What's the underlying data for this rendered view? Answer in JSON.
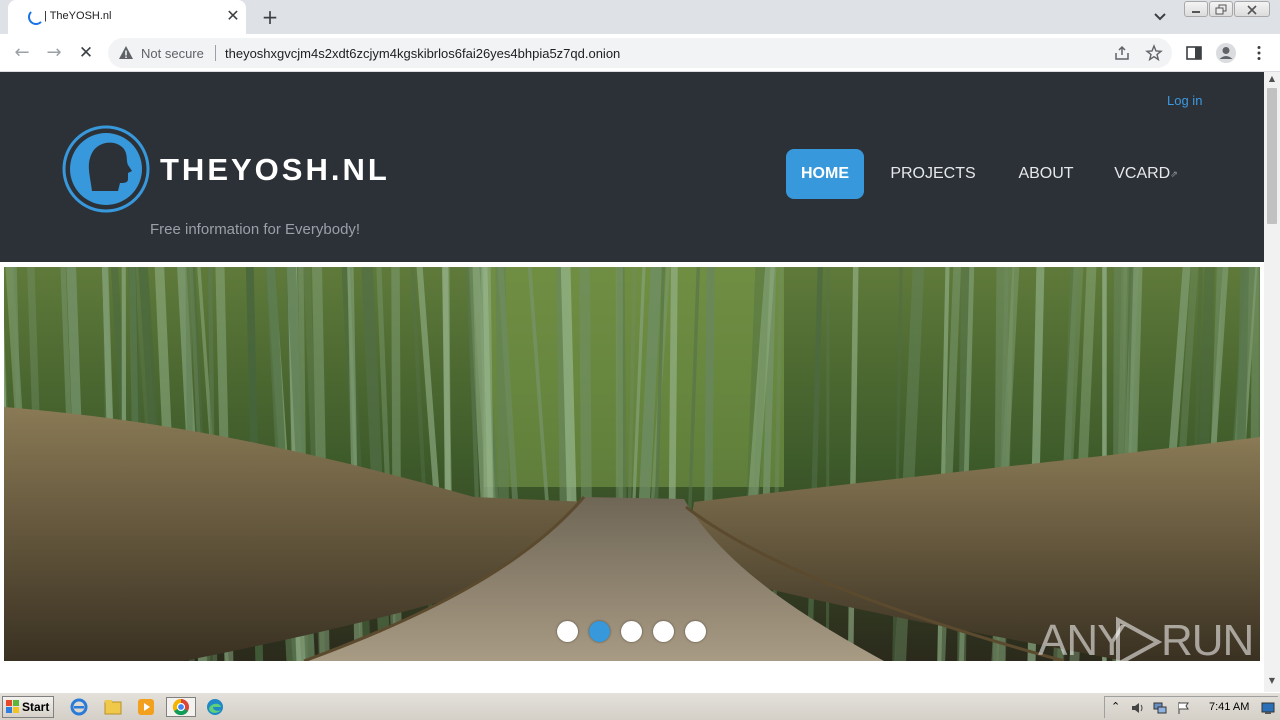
{
  "browser": {
    "tab": {
      "title": "| TheYOSH.nl",
      "close_glyph": "✕"
    },
    "new_tab_glyph": "+",
    "back_glyph": "←",
    "forward_glyph": "→",
    "stop_glyph": "✕",
    "security_label": "Not secure",
    "url": "theyoshxgvcjm4s2xdt6zcjym4kgskibrlos6fai26yes4bhpia5z7qd.onion",
    "icons": [
      "loading-spinner-icon",
      "tab-close-icon",
      "new-tab-icon",
      "tab-list-icon",
      "back-icon",
      "forward-icon",
      "stop-icon",
      "warning-icon",
      "share-icon",
      "bookmark-star-icon",
      "side-panel-icon",
      "profile-icon",
      "menu-icon"
    ]
  },
  "site": {
    "login_label": "Log in",
    "logo_text": "THEYOSH.NL",
    "tagline": "Free information for Everybody!",
    "nav": [
      {
        "label": "HOME",
        "active": true
      },
      {
        "label": "PROJECTS",
        "active": false
      },
      {
        "label": "ABOUT",
        "active": false
      },
      {
        "label": "VCARD",
        "active": false,
        "external": true
      }
    ],
    "external_glyph": "⇗",
    "slider": {
      "slide_count": 5,
      "active_index": 1
    },
    "colors": {
      "header_bg": "#2c3037",
      "accent": "#3798db",
      "tagline": "#9aa0a8"
    }
  },
  "watermark": {
    "left": "ANY",
    "right": "RUN"
  },
  "taskbar": {
    "start_label": "Start",
    "clock": "7:41 AM",
    "apps": [
      "ie-icon",
      "explorer-icon",
      "media-player-icon",
      "chrome-icon",
      "edge-icon"
    ],
    "tray_up_glyph": "⌃",
    "tray_icons": [
      "volume-icon",
      "network-icon",
      "flag-icon",
      "show-desktop-icon"
    ]
  },
  "scrollbar": {
    "up_glyph": "▲",
    "down_glyph": "▼"
  }
}
